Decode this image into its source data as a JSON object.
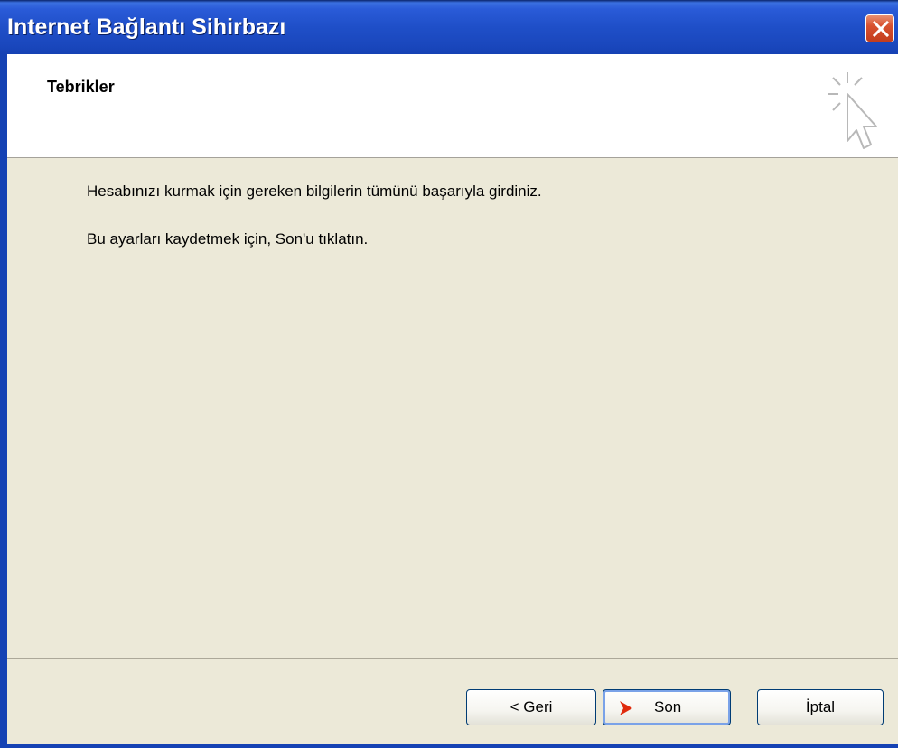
{
  "window": {
    "title": "Internet Bağlantı Sihirbazı"
  },
  "header": {
    "title": "Tebrikler",
    "icon": "wizard-cursor-sparkle-icon"
  },
  "content": {
    "line1": "Hesabınızı kurmak için gereken bilgilerin tümünü başarıyla girdiniz.",
    "line2": "Bu ayarları kaydetmek için, Son'u tıklatın."
  },
  "buttons": {
    "back_label": "< Geri",
    "finish_label": "Son",
    "cancel_label": "İptal"
  },
  "colors": {
    "titlebar": "#1f4fc8",
    "dialog_bg": "#ECE9D8",
    "close_button": "#d8512f",
    "finish_arrow": "#e02a0c"
  }
}
